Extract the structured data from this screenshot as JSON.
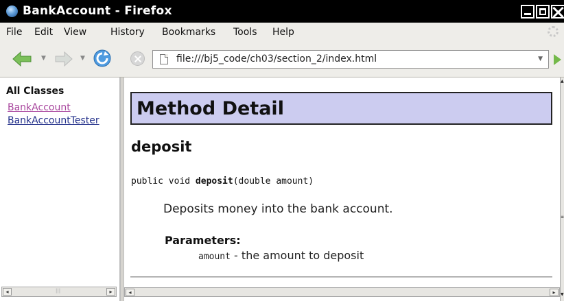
{
  "window": {
    "title": "BankAccount - Firefox",
    "app_icon": "firefox-icon"
  },
  "menu": {
    "items": [
      {
        "label": "File"
      },
      {
        "label": "Edit"
      },
      {
        "label": "View"
      },
      {
        "label": "History"
      },
      {
        "label": "Bookmarks"
      },
      {
        "label": "Tools"
      },
      {
        "label": "Help"
      }
    ]
  },
  "toolbar": {
    "back_icon": "back-arrow-icon",
    "forward_icon": "forward-arrow-icon",
    "reload_icon": "reload-icon",
    "stop_icon": "stop-icon",
    "go_icon": "go-arrow-icon",
    "url": "file:///bj5_code/ch03/section_2/index.html"
  },
  "left_frame": {
    "heading": "All Classes",
    "classes": [
      {
        "label": "BankAccount",
        "visited": true
      },
      {
        "label": "BankAccountTester",
        "visited": false
      }
    ]
  },
  "content": {
    "section_title": "Method Detail",
    "method_name": "deposit",
    "signature": {
      "prefix": "public void ",
      "name": "deposit",
      "params": "(double amount)"
    },
    "description": "Deposits money into the bank account.",
    "parameters_label": "Parameters:",
    "param_name": "amount",
    "param_desc": " - the amount to deposit"
  },
  "colors": {
    "title_bar": "#000000",
    "chrome_bg": "#eeede9",
    "method_header_bg": "#ccccf0",
    "visited_link": "#a8459d",
    "link": "#222f8a",
    "go_button": "#74b94a"
  }
}
